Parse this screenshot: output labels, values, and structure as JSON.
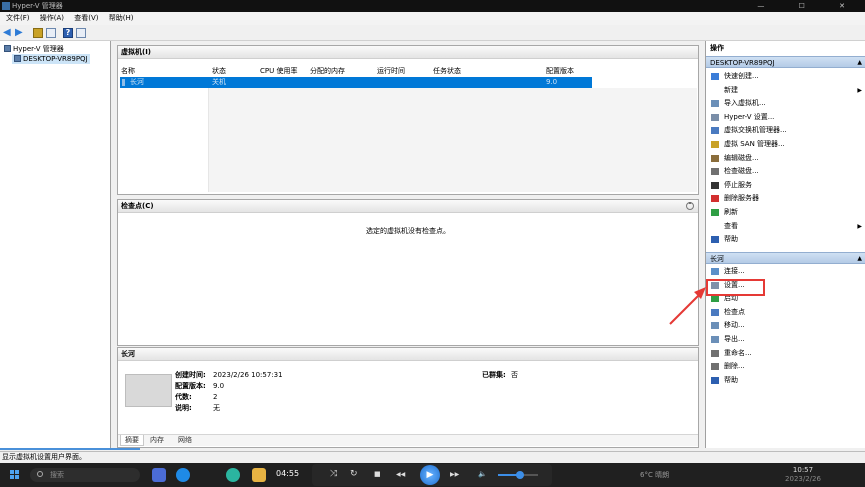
{
  "window": {
    "title": "Hyper-V 管理器",
    "window_controls": "— ☐ ✕"
  },
  "menu": [
    {
      "label": "文件(F)"
    },
    {
      "label": "操作(A)"
    },
    {
      "label": "查看(V)"
    },
    {
      "label": "帮助(H)"
    }
  ],
  "tree": {
    "root": "Hyper-V 管理器",
    "host": "DESKTOP-VR89PQJ"
  },
  "vm_panel": {
    "title": "虚拟机(I)",
    "columns": [
      "名称",
      "状态",
      "CPU 使用率",
      "分配的内存",
      "运行时间",
      "任务状态",
      "配置版本"
    ],
    "rows": [
      {
        "name": "长河",
        "state": "关机",
        "cpu": "",
        "memory": "",
        "uptime": "",
        "task": "",
        "version": "9.0"
      }
    ]
  },
  "checkpoint_panel": {
    "title": "检查点(C)",
    "empty_text": "选定的虚拟机没有检查点。",
    "collapse_glyph": "⌃"
  },
  "details_panel": {
    "title": "长河",
    "created_label": "创建时间:",
    "created_value": "2023/2/26 10:57:31",
    "config_label": "配置版本:",
    "config_value": "9.0",
    "gen_label": "代数:",
    "gen_value": "2",
    "notes_label": "说明:",
    "notes_value": "无",
    "cluster_label": "已群集:",
    "cluster_value": "否",
    "tabs": [
      "摘要",
      "内存",
      "网络"
    ]
  },
  "actions": {
    "title": "操作",
    "host_section": "DESKTOP-VR89PQJ",
    "host_items": [
      {
        "label": "快速创建...",
        "icon": "quick-create-icon",
        "color": "#3b7dd8"
      },
      {
        "label": "新建",
        "icon": "new-icon",
        "color": "#ffffff",
        "submenu": true
      },
      {
        "label": "导入虚拟机...",
        "icon": "import-icon",
        "color": "#6b8fb8"
      },
      {
        "label": "Hyper-V 设置...",
        "icon": "hyperv-settings-icon",
        "color": "#7a8ea8"
      },
      {
        "label": "虚拟交换机管理器...",
        "icon": "switch-manager-icon",
        "color": "#4a7ac0"
      },
      {
        "label": "虚拟 SAN 管理器...",
        "icon": "san-manager-icon",
        "color": "#c9a227"
      },
      {
        "label": "编辑磁盘...",
        "icon": "edit-disk-icon",
        "color": "#8a6d3b"
      },
      {
        "label": "检查磁盘...",
        "icon": "inspect-disk-icon",
        "color": "#707070"
      },
      {
        "label": "停止服务",
        "icon": "stop-service-icon",
        "color": "#333333"
      },
      {
        "label": "删除服务器",
        "icon": "remove-server-icon",
        "color": "#d32f2f"
      },
      {
        "label": "刷新",
        "icon": "refresh-icon",
        "color": "#2e9e44"
      },
      {
        "label": "查看",
        "icon": "view-icon",
        "color": "#ffffff",
        "submenu": true
      },
      {
        "label": "帮助",
        "icon": "help-icon",
        "color": "#2d5fb0"
      }
    ],
    "vm_section": "长河",
    "vm_items": [
      {
        "label": "连接...",
        "icon": "connect-icon",
        "color": "#5b8fc9"
      },
      {
        "label": "设置...",
        "icon": "settings-icon",
        "color": "#8090a8"
      },
      {
        "label": "启动",
        "icon": "start-icon",
        "color": "#2e9e44"
      },
      {
        "label": "检查点",
        "icon": "checkpoint-icon",
        "color": "#4a7ac0"
      },
      {
        "label": "移动...",
        "icon": "move-icon",
        "color": "#6b8fb8"
      },
      {
        "label": "导出...",
        "icon": "export-icon",
        "color": "#6b8fb8"
      },
      {
        "label": "重命名...",
        "icon": "rename-icon",
        "color": "#707070"
      },
      {
        "label": "删除...",
        "icon": "delete-icon",
        "color": "#707070"
      },
      {
        "label": "帮助",
        "icon": "help-icon",
        "color": "#2d5fb0"
      }
    ],
    "section_caret": "▲",
    "submenu_caret": "▶"
  },
  "status_bar": {
    "text": "显示虚拟机设置用户界面。"
  },
  "taskbar": {
    "search_placeholder": "搜索",
    "weather": "6°C 晴朗",
    "clock_time": "10:57",
    "clock_date": "2023/2/26"
  },
  "media_player": {
    "time": "04:55",
    "volume_percent": 55,
    "buttons": {
      "shuffle": "⤨",
      "repeat": "↻",
      "stop": "■",
      "prev": "◀◀",
      "play": "▶",
      "next": "▶▶",
      "volume": "🔈"
    }
  },
  "annotation": {
    "highlight_color": "#e53935"
  }
}
